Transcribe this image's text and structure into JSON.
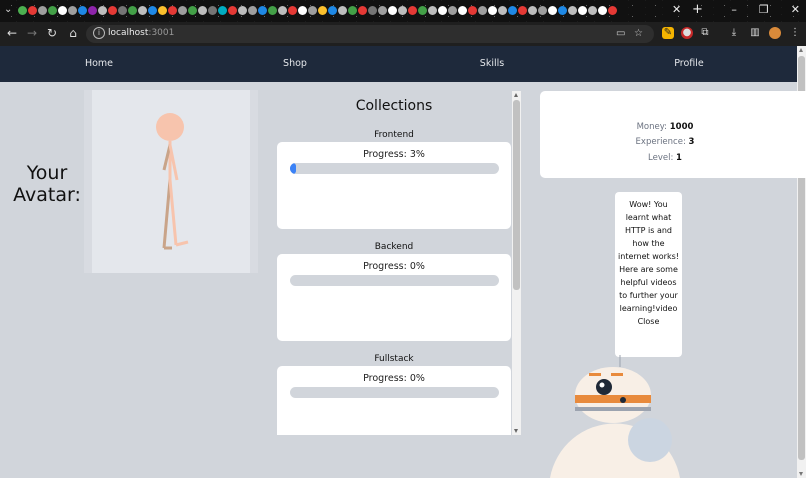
{
  "browser": {
    "url_host": "localhost",
    "url_port": ":3001"
  },
  "nav": {
    "items": [
      {
        "label": "Home"
      },
      {
        "label": "Shop"
      },
      {
        "label": "Skills"
      },
      {
        "label": "Profile"
      }
    ]
  },
  "avatar": {
    "label_line1": "Your",
    "label_line2": "Avatar:"
  },
  "collections": {
    "title": "Collections",
    "items": [
      {
        "name": "Frontend",
        "progress_text": "Progress: 3%",
        "progress": 3
      },
      {
        "name": "Backend",
        "progress_text": "Progress: 0%",
        "progress": 0
      },
      {
        "name": "Fullstack",
        "progress_text": "Progress: 0%",
        "progress": 0
      }
    ]
  },
  "stats": {
    "money_label": "Money:",
    "money_value": "1000",
    "experience_label": "Experience:",
    "experience_value": "3",
    "level_label": "Level:",
    "level_value": "1"
  },
  "bubble": {
    "message": "Wow! You learnt what HTTP is and how the internet works! Here are some helpful videos to further your learning!video",
    "close_label": "Close"
  },
  "colors": {
    "accent": "#3b82f6",
    "nav_bg": "#1e293b",
    "page_bg": "#d1d5db"
  }
}
